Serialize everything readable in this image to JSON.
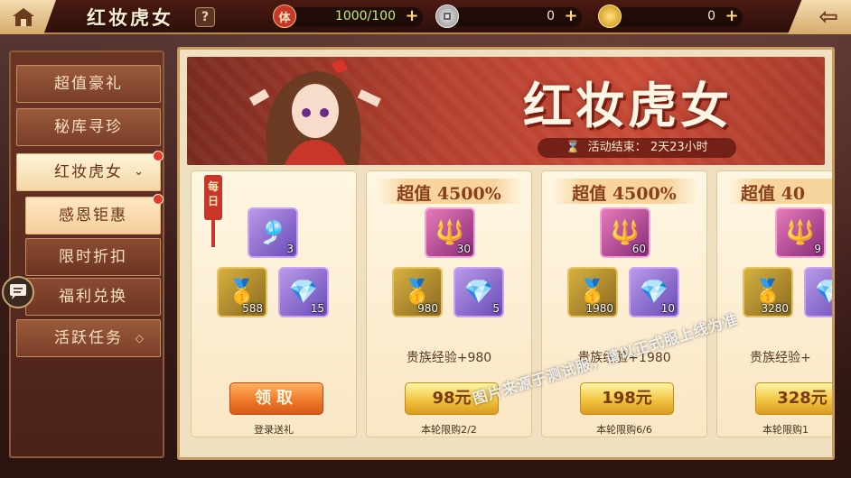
{
  "topbar": {
    "title": "红妆虎女",
    "help": "?",
    "stamina": {
      "icon_text": "体",
      "value": "1000/100"
    },
    "silver": {
      "value": "0"
    },
    "gold": {
      "value": "0"
    },
    "plus": "+",
    "back_icon": "arrow-left-icon"
  },
  "sidebar": {
    "items": [
      {
        "label": "超值豪礼"
      },
      {
        "label": "秘库寻珍"
      },
      {
        "label": "红妆虎女",
        "arrow": "⌄"
      },
      {
        "label": "感恩钜惠"
      },
      {
        "label": "限时折扣"
      },
      {
        "label": "福利兑换"
      },
      {
        "label": "活跃任务",
        "diamond": "◇"
      }
    ]
  },
  "banner": {
    "title": "红妆虎女",
    "timer_prefix": "活动结束：",
    "timer_value": "2天23小时"
  },
  "cards": [
    {
      "daily_tag": "每日",
      "items": [
        {
          "count": "3"
        },
        {
          "count": "588"
        },
        {
          "count": "15"
        }
      ],
      "button": "领取",
      "limit": "登录送礼"
    },
    {
      "title": "超值 4500%",
      "items": [
        {
          "count": "30"
        },
        {
          "count": "980"
        },
        {
          "count": "5"
        }
      ],
      "exp": "贵族经验+980",
      "button": "98元",
      "limit": "本轮限购2/2"
    },
    {
      "title": "超值 4500%",
      "items": [
        {
          "count": "60"
        },
        {
          "count": "1980"
        },
        {
          "count": "10"
        }
      ],
      "exp": "贵族经验+1980",
      "button": "198元",
      "limit": "本轮限购6/6"
    },
    {
      "title": "超值 40",
      "items": [
        {
          "count": "9"
        },
        {
          "count": "3280"
        },
        {
          "count": ""
        }
      ],
      "exp": "贵族经验+",
      "button": "328元",
      "limit": "本轮限购1"
    }
  ],
  "watermark": "图片来源于测试服，请以正式服上线为准"
}
